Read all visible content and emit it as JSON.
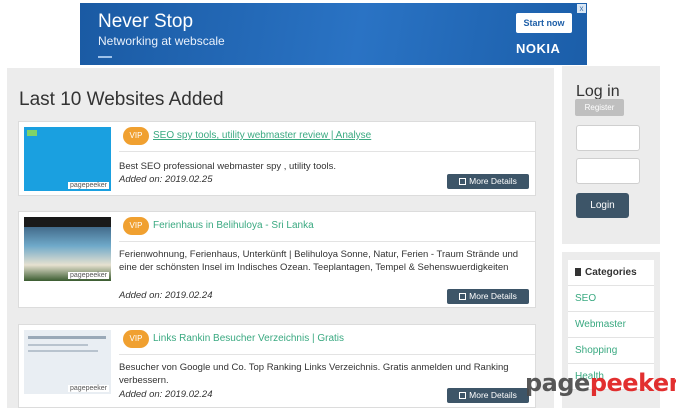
{
  "ad": {
    "headline": "Never Stop",
    "subline": "Networking at webscale",
    "cta": "Start now",
    "brand": "NOKIA",
    "close": "x"
  },
  "main": {
    "title": "Last 10 Websites Added",
    "vip_label": "VIP",
    "more_label": "More Details",
    "thumb_brand": "pagepeeker",
    "sites": [
      {
        "title": "SEO spy tools, utility webmaster review | Analyse",
        "description": "Best SEO professional webmaster spy , utility tools.",
        "date": "Added on: 2019.02.25"
      },
      {
        "title": "Ferienhaus in Belihuloya - Sri Lanka",
        "description": "Ferienwohnung, Ferienhaus, Unterkünft | Belihuloya Sonne, Natur, Ferien - Traum Strände und eine der schönsten Insel im Indisches Ozean. Teeplantagen, Tempel & Sehenswuerdigkeiten",
        "date": "Added on: 2019.02.24"
      },
      {
        "title": "Links Rankin Besucher Verzeichnis | Gratis",
        "description": "Besucher von Google und Co. Top Ranking Links Verzeichnis. Gratis anmelden und Ranking verbessern.",
        "date": "Added on: 2019.02.24"
      }
    ]
  },
  "login": {
    "title": "Log in",
    "register": "Register",
    "submit": "Login"
  },
  "categories": {
    "title": "Categories",
    "items": [
      "SEO",
      "Webmaster",
      "Shopping",
      "Health"
    ]
  },
  "watermark": {
    "part1": "page",
    "part2": "peeker"
  }
}
